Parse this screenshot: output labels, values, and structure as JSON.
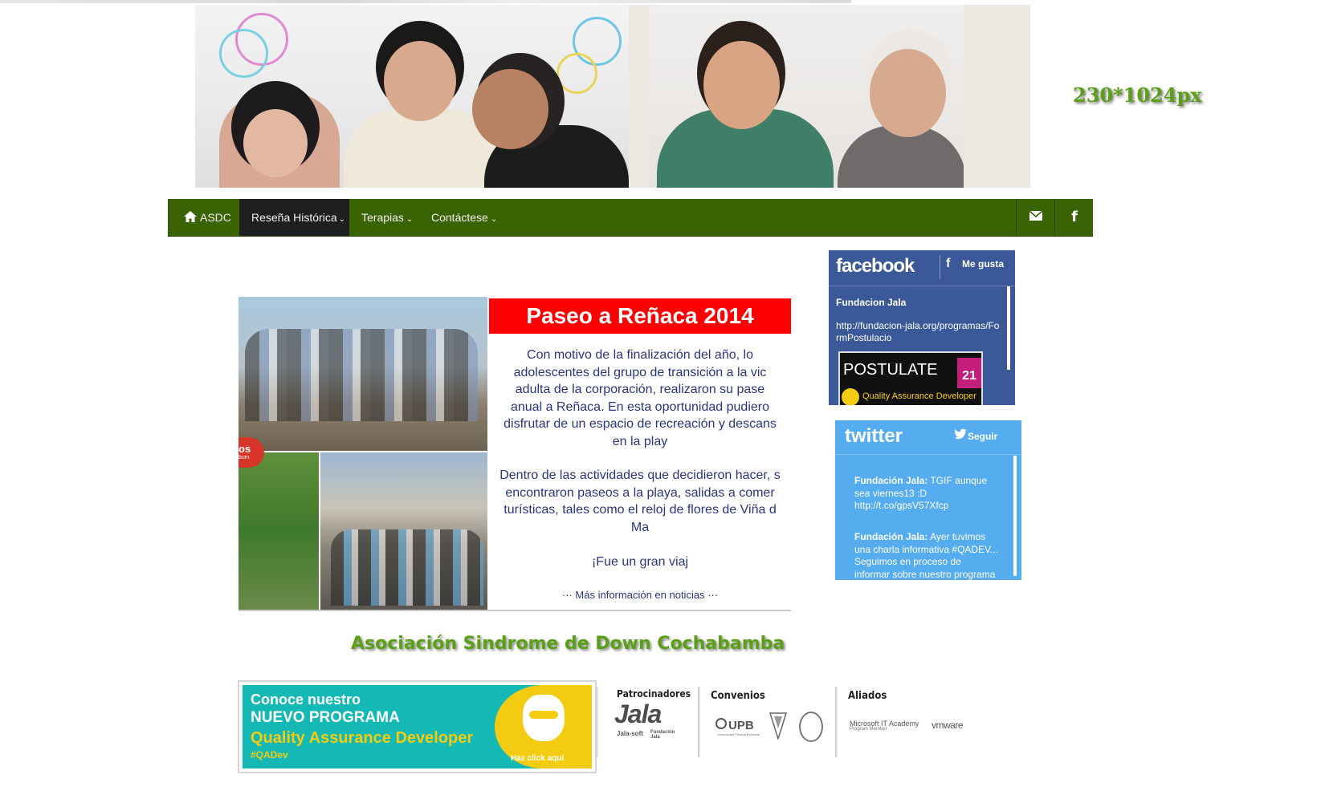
{
  "header": {
    "size_label": "230*1024px"
  },
  "nav": {
    "items": [
      {
        "label": "ASDC"
      },
      {
        "label": "Reseña Histórica"
      },
      {
        "label": "Terapias"
      },
      {
        "label": "Contáctese"
      }
    ],
    "icons": [
      "mail-icon",
      "facebook-icon"
    ],
    "colors": {
      "bar": "#3a6304",
      "active": "#1e1e1e"
    }
  },
  "slide": {
    "title": "Paseo a Reñaca 2014",
    "paragraph1": [
      "Con motivo de la finalización del año, lo",
      "adolescentes  del grupo de transición a la vic",
      "adulta de la corporación, realizaron su pase",
      "anual  a  Reñaca.   En esta oportunidad  pudiero",
      "disfrutar de un  espacio de recreación y descans",
      "en  la play"
    ],
    "paragraph2": [
      "Dentro de las actividades que decidieron hacer, s",
      "encontraron paseos a la playa, salidas a comer",
      "turísticas, tales como el reloj de flores de Viña d",
      "Ma"
    ],
    "closing": "¡Fue un gran viaj",
    "more": "··· Más información en noticias ···",
    "badge": "os",
    "badge_sub": "bum"
  },
  "facebook": {
    "logo": "facebook",
    "like": "Me gusta",
    "page_name": "Fundacion Jala",
    "link": "http://fundacion-jala.org/programas/FormPostulacio",
    "post_title": "POSTULATE",
    "post_sub": "Quality Assurance Developer",
    "post_day": "21"
  },
  "twitter": {
    "logo": "twitter",
    "follow": "Seguir",
    "tweets": [
      {
        "author": "Fundación Jala:",
        "text": " TGIF aunque sea viernes13 :D http://t.co/gpsV57Xfcp"
      },
      {
        "author": "Fundación Jala:",
        "text": " Ayer tuvimos una charla informativa #QADEV... Seguimos en proceso de informar sobre nuestro programa"
      }
    ]
  },
  "association": "Asociación Sindrome de Down Cochabamba",
  "footer": {
    "qa": {
      "line1": "Conoce nuestro",
      "line2": "NUEVO PROGRAMA",
      "line3": "Quality Assurance Developer",
      "tag": "#QADev",
      "cta": "Haz click aquí"
    },
    "sponsors": {
      "label": "Patrocinadores",
      "logo": "Jala",
      "sub1": "Jala-soft",
      "sub2": "Fundación Jala"
    },
    "agreements": {
      "label": "Convenios",
      "logo": "UPB",
      "sub": "Universidad Privada Boliviana"
    },
    "allies": {
      "label": "Aliados",
      "ms": "Microsoft IT Academy",
      "ms_sub": "Program Member",
      "vm": "vmware"
    }
  }
}
